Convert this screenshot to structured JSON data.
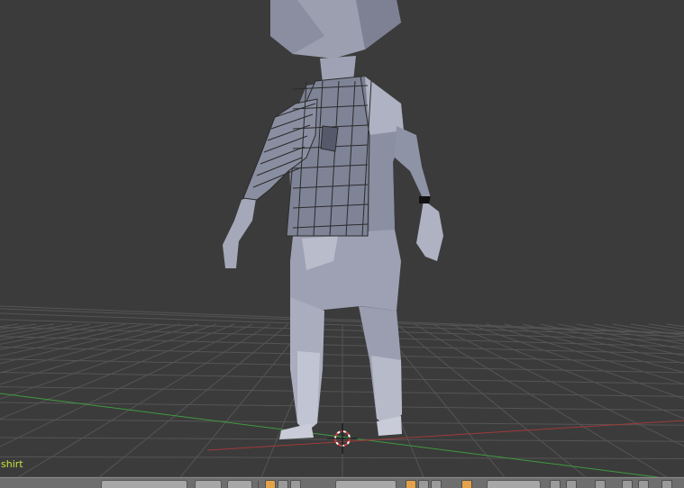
{
  "viewport": {
    "object_name": "shirt",
    "colors": {
      "background": "#3b3b3b",
      "grid": "#555555",
      "x_axis": "#a03a3a",
      "y_axis": "#3f9a3f",
      "mesh": "#8e93a6",
      "wire": "#2b2b2b",
      "object_name_text": "#c8e040",
      "cursor": "#d23b3b"
    },
    "icons": {
      "cursor": "3d-cursor-icon"
    }
  },
  "header": {
    "icons": [
      "object-interaction-mode-icon",
      "viewport-shading-icon",
      "pivot-point-icon",
      "manipulator-icon",
      "transform-orientation-icon",
      "layers-icon",
      "lock-icon",
      "proportional-editing-icon",
      "snap-icon",
      "render-icon"
    ]
  }
}
